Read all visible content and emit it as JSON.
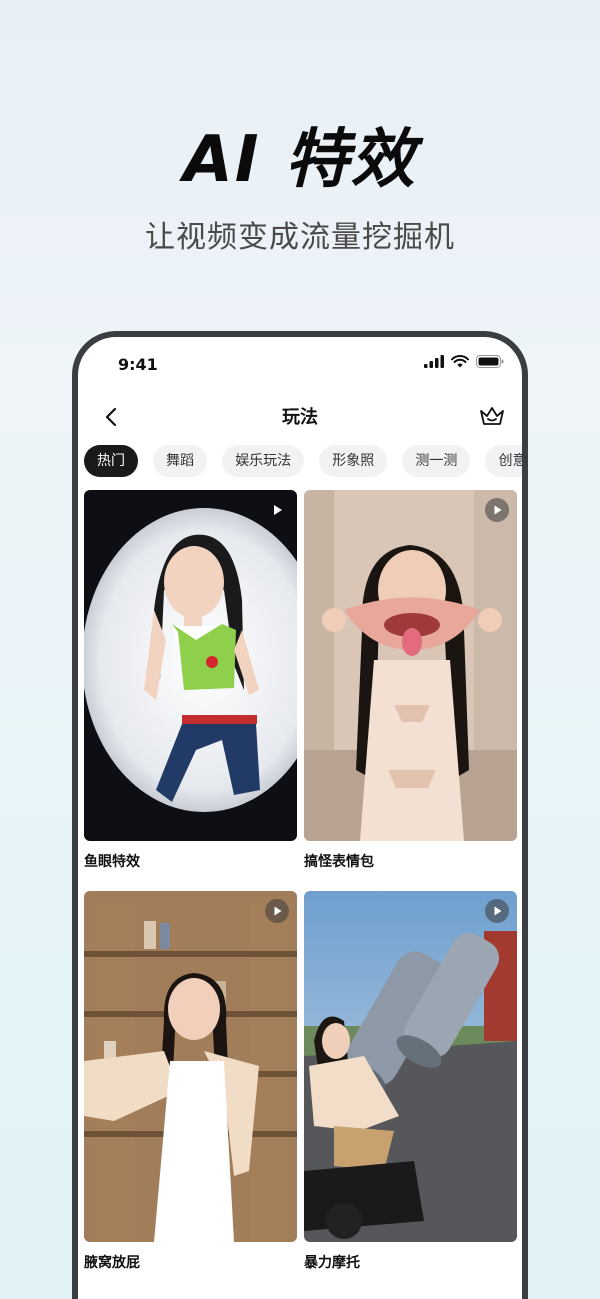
{
  "hero": {
    "title": "AI 特效",
    "subtitle": "让视频变成流量挖掘机"
  },
  "status_bar": {
    "time": "9:41",
    "icons": [
      "cellular-signal-icon",
      "wifi-icon",
      "battery-icon"
    ]
  },
  "nav": {
    "title": "玩法",
    "back_icon": "back-arrow-icon",
    "right_icon": "crown-icon"
  },
  "tabs": [
    {
      "label": "热门",
      "active": true
    },
    {
      "label": "舞蹈",
      "active": false
    },
    {
      "label": "娱乐玩法",
      "active": false
    },
    {
      "label": "形象照",
      "active": false
    },
    {
      "label": "测一测",
      "active": false
    },
    {
      "label": "创意营销",
      "active": false
    }
  ],
  "effects": [
    {
      "label": "鱼眼特效",
      "icon": "play-icon"
    },
    {
      "label": "搞怪表情包",
      "icon": "play-icon"
    },
    {
      "label": "腋窝放屁",
      "icon": "play-icon"
    },
    {
      "label": "暴力摩托",
      "icon": "play-icon"
    }
  ],
  "colors": {
    "active_tab_bg": "#1a1a1a",
    "inactive_tab_bg": "#f1f2f4",
    "phone_frame": "#3a3d42"
  }
}
